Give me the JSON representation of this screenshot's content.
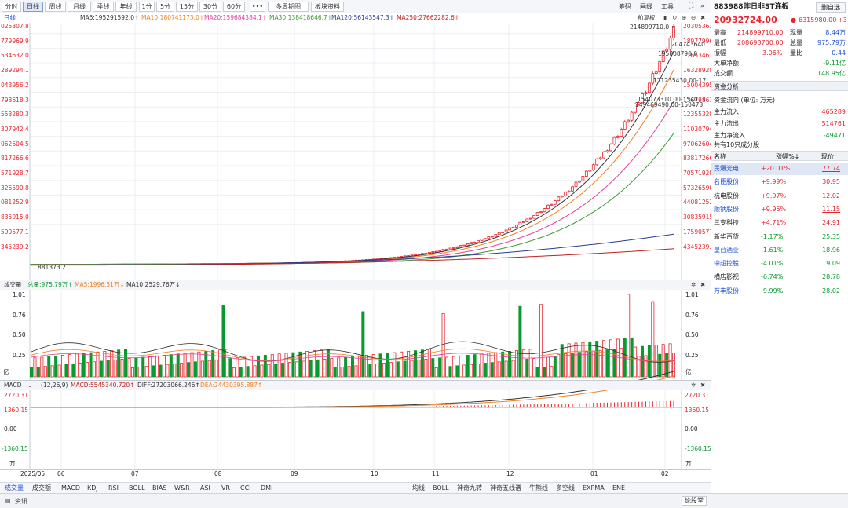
{
  "toolbar": {
    "periods": [
      "分时",
      "日线",
      "周线",
      "月线",
      "季线",
      "年线",
      "1分",
      "5分",
      "15分",
      "30分",
      "60分"
    ],
    "active": "日线",
    "more": "•••",
    "multi": "多周期图",
    "info": "板块资料",
    "right": [
      "筹码",
      "画线",
      "工具"
    ]
  },
  "legend": {
    "period": "日线",
    "ma5": "MA5:195291592.0↑",
    "ma10": "MA10:180741173.0↑",
    "ma20": "MA20:159684384.1↑",
    "ma30": "MA30:138418646.7↑",
    "ma120": "MA120:56143547.3↑",
    "ma250": "MA250:27662282.6↑",
    "adjust": "前复权"
  },
  "price_axis": {
    "left": [
      "025307.8",
      "779969.9",
      "534632.0",
      "289294.1",
      "043956.2",
      "798618.3",
      "553280.3",
      "307942.4",
      "062604.5",
      "817266.6",
      "571928.7",
      "326590.8",
      "081252.9",
      "835915.0",
      "590577.1",
      "345239.2"
    ],
    "right": [
      "20305363",
      "18977996",
      "17653463",
      "16328929",
      "15004395",
      "13679861",
      "12355328",
      "11030794",
      "97062604.",
      "83817266.",
      "70571928.",
      "57326590.",
      "44081252.",
      "30835915.",
      "17590577.",
      "4345239."
    ]
  },
  "annotations": {
    "high": "214899710.0→",
    "a1": "204743640.",
    "a2": "195808790.0",
    "a3": "171235430.00-17",
    "a4": "154073310.00-154073",
    "a5": "149469490.00-150473",
    "low": "881373.2"
  },
  "volume": {
    "title": "成交量",
    "total": "总量:975.79万↑",
    "ma5": "MA5:1996.51万↓",
    "ma10": "MA10:2529.76万↓",
    "axis": [
      "1.01",
      "0.76",
      "0.50",
      "0.25"
    ],
    "unit": "亿"
  },
  "macd": {
    "title": "MACD",
    "params": "(12,26,9)",
    "macd": "MACD:5545340.720↑",
    "diff": "DIFF:27203066.246↑",
    "dea": "DEA:24430395.887↑",
    "axis": [
      "2720.31",
      "1360.15",
      "0.00",
      "-1360.15"
    ],
    "unit": "万"
  },
  "dates": [
    "2025/05",
    "06",
    "07",
    "08",
    "09",
    "10",
    "11",
    "12",
    "01",
    "02"
  ],
  "bottom_tabs": {
    "left": [
      "成交量",
      "成交额",
      "MACD",
      "KDJ",
      "RSI",
      "BOLL",
      "BIAS",
      "W&R",
      "ASI",
      "VR",
      "CCI",
      "DMI"
    ],
    "right": [
      "均线",
      "BOLL",
      "神奇九转",
      "神奇五线谱",
      "牛熊线",
      "多空线",
      "EXPMA",
      "ENE"
    ]
  },
  "footer": {
    "news": "资讯",
    "login": "论股堂"
  },
  "panel": {
    "code": "883988",
    "name": "昨日非ST连板",
    "self_btn": "删自选",
    "price": "20932724.00",
    "arrow": "●",
    "change": "6315980.00",
    "pct": "+3",
    "stats": [
      {
        "k1": "最高",
        "v1": "214899710.00",
        "k2": "现量",
        "v2": "8.44万"
      },
      {
        "k1": "最低",
        "v1": "208693700.00",
        "k2": "总量",
        "v2": "975.79万"
      },
      {
        "k1": "振幅",
        "v1": "3.06%",
        "k2": "量比",
        "v2": "0.44"
      },
      {
        "k1": "大单净额",
        "v1": "",
        "k2": "",
        "v2": "-9.11亿"
      },
      {
        "k1": "成交额",
        "v1": "",
        "k2": "",
        "v2": "148.95亿"
      }
    ],
    "fund_title": "资金分析",
    "fund_unit": "资金流向 (单位: 万元)",
    "fund": [
      {
        "k": "主力流入",
        "v": "465289"
      },
      {
        "k": "主力流出",
        "v": "514761"
      },
      {
        "k": "主力净流入",
        "v": "-49471"
      }
    ],
    "members_title": "共有10只成分股",
    "cols": [
      "名称",
      "涨幅%↓",
      "现价"
    ],
    "stocks": [
      {
        "name": "民爆光电",
        "pct": "+20.01%",
        "price": "77.74"
      },
      {
        "name": "名臣股份",
        "pct": "+9.99%",
        "price": "30.95"
      },
      {
        "name": "杭电股份",
        "pct": "+9.97%",
        "price": "12.02"
      },
      {
        "name": "顺钠股份",
        "pct": "+9.96%",
        "price": "11.15"
      },
      {
        "name": "三变科技",
        "pct": "+4.71%",
        "price": "24.91"
      },
      {
        "name": "新华百货",
        "pct": "-1.17%",
        "price": "25.35"
      },
      {
        "name": "皇台酒业",
        "pct": "-1.61%",
        "price": "18.96"
      },
      {
        "name": "中超控股",
        "pct": "-4.01%",
        "price": "9.09"
      },
      {
        "name": "横店影视",
        "pct": "-6.74%",
        "price": "28.78"
      },
      {
        "name": "万丰股份",
        "pct": "-9.99%",
        "price": "28.02"
      }
    ]
  },
  "colors": {
    "up": "#e8232d",
    "down": "#099a2e",
    "ma5": "#333333",
    "ma10": "#f08020",
    "ma20": "#e0409a",
    "ma30": "#3c9a30",
    "ma120": "#2a3c90",
    "ma250": "#c02020"
  }
}
